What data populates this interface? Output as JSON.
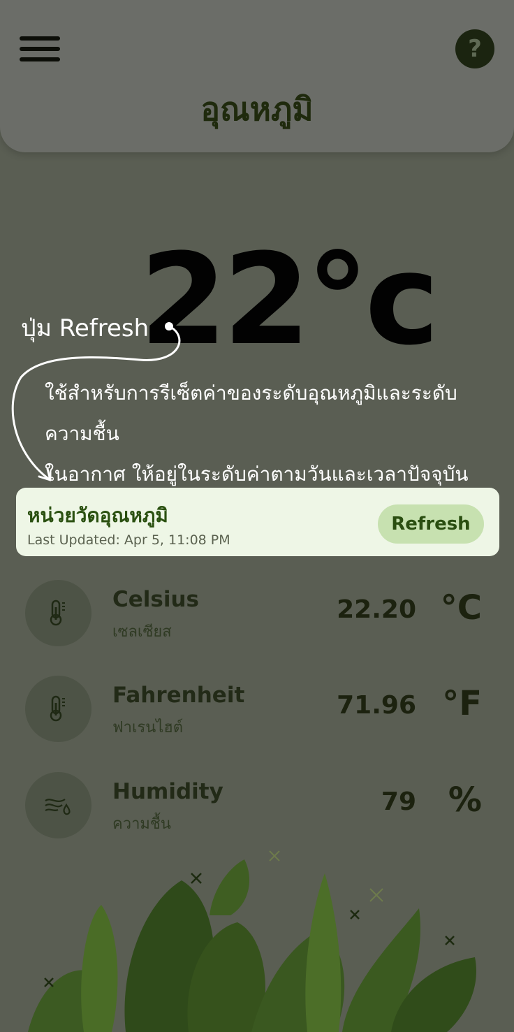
{
  "header": {
    "title": "อุณหภูมิ",
    "menu_icon": "hamburger-menu-icon",
    "help_icon": "help-question-icon",
    "help_symbol": "?"
  },
  "main": {
    "temperature_value": "22",
    "temperature_unit": "°c"
  },
  "annotation": {
    "title": "ปุ่ม Refresh",
    "description_line1": "ใช้สำหรับการรีเซ็ตค่าของระดับอุณหภูมิและระดับความชื้น",
    "description_line2": "ในอากาศ ให้อยู่ในระดับค่าตามวันและเวลาปัจจุบัน"
  },
  "card": {
    "title": "หน่วยวัดอุณหภูมิ",
    "last_updated": "Last Updated: Apr 5, 11:08 PM",
    "refresh_label": "Refresh"
  },
  "readings": [
    {
      "label": "Celsius",
      "sublabel": "เซลเซียส",
      "value": "22.20",
      "unit": "°C",
      "icon": "thermometer-icon"
    },
    {
      "label": "Fahrenheit",
      "sublabel": "ฟาเรนไฮต์",
      "value": "71.96",
      "unit": "°F",
      "icon": "thermometer-icon"
    },
    {
      "label": "Humidity",
      "sublabel": "ความชื้น",
      "value": "79",
      "unit": "%",
      "icon": "humidity-icon"
    }
  ],
  "colors": {
    "background": "#5a5e53",
    "card": "#eef6e6",
    "accent": "#2a5010",
    "button": "#c7e1b0"
  }
}
